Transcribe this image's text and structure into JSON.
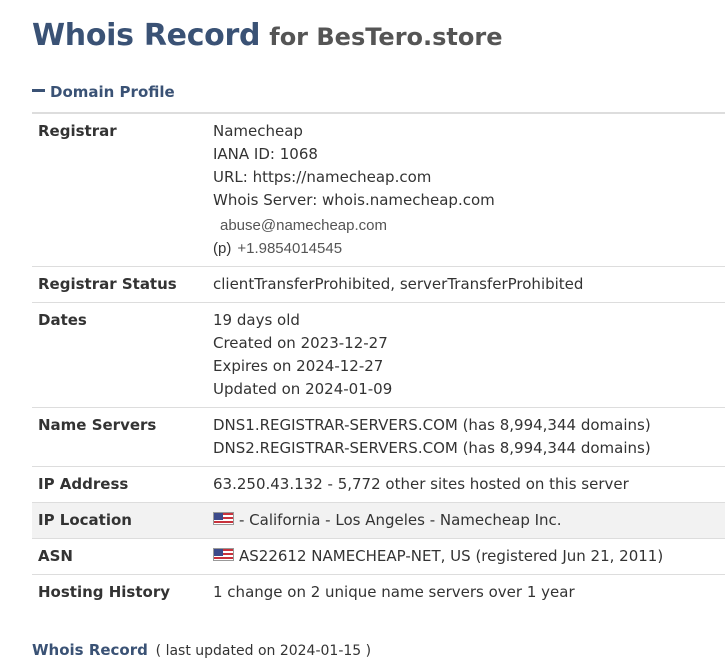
{
  "header": {
    "title": "Whois Record",
    "for_text": "for BesTero.store"
  },
  "section": {
    "label": "Domain Profile",
    "toggle_icon": "minus-icon"
  },
  "registrar": {
    "label": "Registrar",
    "name": "Namecheap",
    "iana": "IANA ID: 1068",
    "url": "URL: https://namecheap.com",
    "whois_server": "Whois Server: whois.namecheap.com",
    "email": "abuse@namecheap.com",
    "phone_label": "(p)",
    "phone": "+1.9854014545"
  },
  "registrar_status": {
    "label": "Registrar Status",
    "value": "clientTransferProhibited, serverTransferProhibited"
  },
  "dates": {
    "label": "Dates",
    "age": "19 days old",
    "created": "Created on 2023-12-27",
    "expires": "Expires on 2024-12-27",
    "updated": "Updated on 2024-01-09"
  },
  "name_servers": {
    "label": "Name Servers",
    "ns1": "DNS1.REGISTRAR-SERVERS.COM (has 8,994,344 domains)",
    "ns2": "DNS2.REGISTRAR-SERVERS.COM (has 8,994,344 domains)"
  },
  "ip_address": {
    "label": "IP Address",
    "value": "63.250.43.132 - 5,772 other sites hosted on this server"
  },
  "ip_location": {
    "label": "IP Location",
    "flag_icon": "us-flag-icon",
    "value": "- California - Los Angeles - Namecheap Inc."
  },
  "asn": {
    "label": "ASN",
    "flag_icon": "us-flag-icon",
    "value": "AS22612 NAMECHEAP-NET, US (registered Jun 21, 2011)"
  },
  "hosting_history": {
    "label": "Hosting History",
    "value": "1 change on 2 unique name servers over 1 year"
  },
  "footer": {
    "link": "Whois Record",
    "note": "( last updated on 2024-01-15 )"
  },
  "colors": {
    "title": "#3a5275",
    "text": "#333333",
    "shade": "#f2f2f2",
    "border": "#dddddd"
  }
}
